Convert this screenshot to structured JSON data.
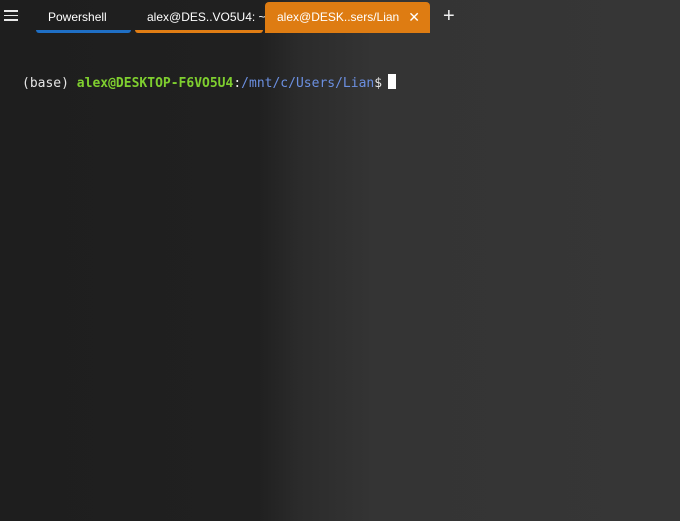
{
  "tabs": [
    {
      "label": "Powershell",
      "accent": "#1f6fc5"
    },
    {
      "label": "alex@DES..VO5U4: ~",
      "accent": "#e07d14"
    },
    {
      "label": "alex@DESK..sers/Lian",
      "accent": "#de7c12",
      "active": true
    }
  ],
  "icons": {
    "menu": "hamburger-menu-icon",
    "close": "close-icon",
    "new_tab": "plus-icon"
  },
  "glyphs": {
    "close": "✕",
    "new_tab": "+"
  },
  "terminal": {
    "prefix": "(base) ",
    "user_host": "alex@DESKTOP-F6VO5U4",
    "separator": ":",
    "path": "/mnt/c/Users/Lian",
    "dollar": "$"
  },
  "colors": {
    "user_host": "#7fcf2f",
    "path": "#6b8fe0",
    "active_tab": "#de7c12"
  }
}
